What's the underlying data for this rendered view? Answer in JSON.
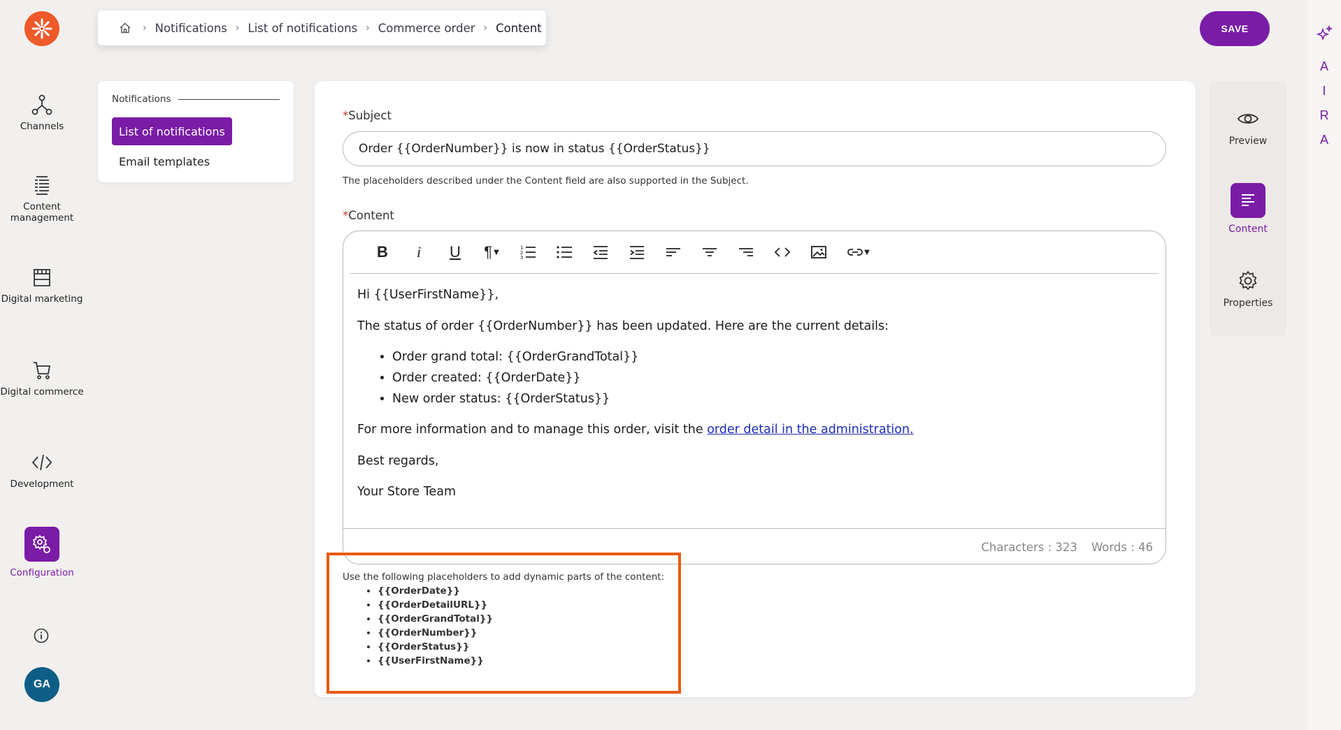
{
  "colors": {
    "accent": "#7a1ca6",
    "logo": "#f0592a",
    "highlight_border": "#ea5a0c",
    "avatar": "#0d5e86",
    "link": "#1d2bb8"
  },
  "nav": {
    "items": [
      {
        "label": "Channels",
        "icon": "channels-icon"
      },
      {
        "label": "Content management",
        "icon": "content-management-icon"
      },
      {
        "label": "Digital marketing",
        "icon": "storefront-icon"
      },
      {
        "label": "Digital commerce",
        "icon": "cart-icon"
      },
      {
        "label": "Development",
        "icon": "code-icon"
      },
      {
        "label": "Configuration",
        "icon": "gear-icon",
        "active": true
      }
    ],
    "avatar_initials": "GA"
  },
  "breadcrumb": {
    "items": [
      "Notifications",
      "List of notifications",
      "Commerce order"
    ],
    "current": "Content"
  },
  "toolbar": {
    "save_label": "SAVE"
  },
  "aira": {
    "letters": [
      "A",
      "I",
      "R",
      "A"
    ]
  },
  "notifications_panel": {
    "heading": "Notifications",
    "items": [
      {
        "label": "List of notifications",
        "active": true
      },
      {
        "label": "Email templates"
      }
    ]
  },
  "form": {
    "subject_label": "Subject",
    "required_mark": "*",
    "subject_value": "Order {{OrderNumber}} is now in status {{OrderStatus}}",
    "subject_hint": "The placeholders described under the Content field are also supported in the Subject.",
    "content_label": "Content",
    "editor": {
      "greeting": "Hi {{UserFirstName}},",
      "intro": "The status of order {{OrderNumber}} has been updated. Here are the current details:",
      "details": [
        "Order grand total: {{OrderGrandTotal}}",
        "Order created: {{OrderDate}}",
        "New order status: {{OrderStatus}}"
      ],
      "more_info_prefix": "For more information and to manage this order, visit the ",
      "more_info_link": "order detail in the administration.",
      "regards": "Best regards,",
      "signature": "Your Store Team",
      "characters": "Characters : 323",
      "words": "Words : 46"
    },
    "placeholders_intro": "Use the following placeholders to add dynamic parts of the content:",
    "placeholders": [
      "{{OrderDate}}",
      "{{OrderDetailURL}}",
      "{{OrderGrandTotal}}",
      "{{OrderNumber}}",
      "{{OrderStatus}}",
      "{{UserFirstName}}"
    ]
  },
  "side_panel": {
    "items": [
      {
        "label": "Preview",
        "icon": "eye-icon"
      },
      {
        "label": "Content",
        "icon": "content-icon",
        "active": true
      },
      {
        "label": "Properties",
        "icon": "gear-icon"
      }
    ]
  }
}
